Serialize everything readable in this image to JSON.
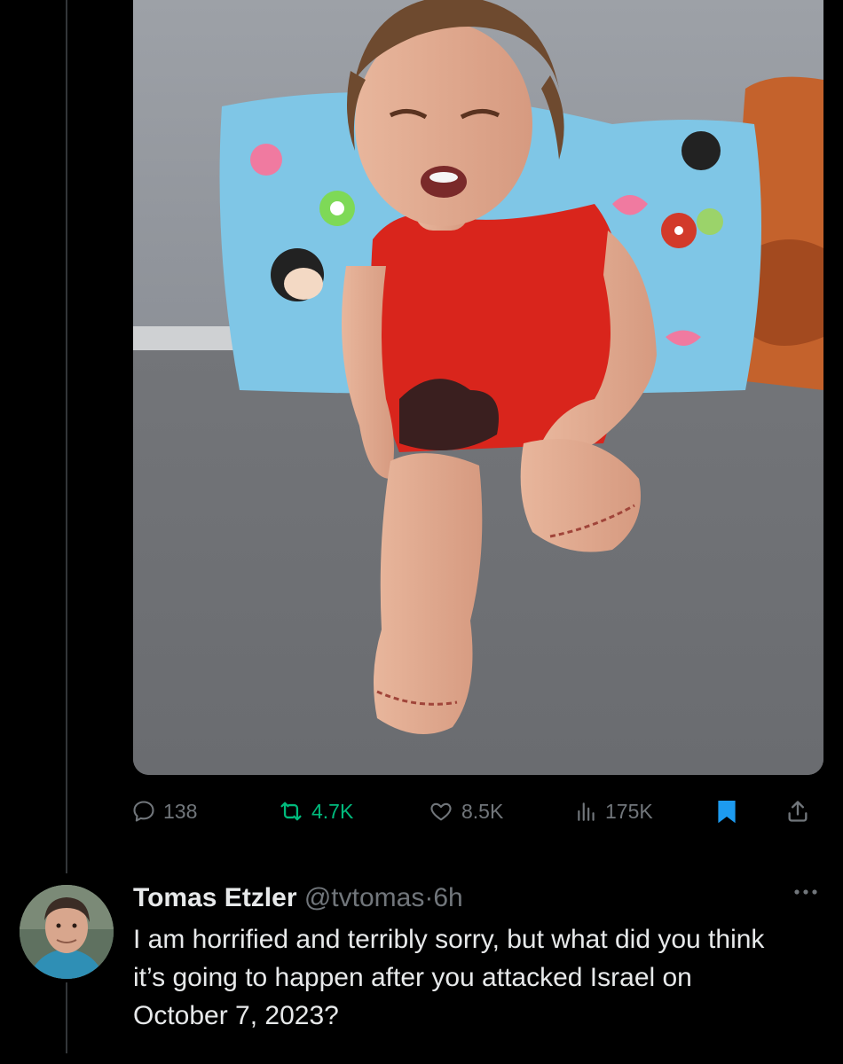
{
  "post": {
    "media_alt": "Photo of a crying toddler in a red top sitting on a grey mattress in front of cartoon pillows, with both lower legs amputated",
    "metrics": {
      "replies": "138",
      "reposts": "4.7K",
      "likes": "8.5K",
      "views": "175K"
    }
  },
  "reply": {
    "display_name": "Tomas Etzler",
    "handle": "@tvtomas",
    "separator": "·",
    "time": "6h",
    "text": "I am horrified and terribly sorry, but what did you think it’s going to happen after you attacked Israel on October 7, 2023?"
  },
  "icons": {
    "reply": "speech-bubble-icon",
    "repost": "repost-arrows-icon",
    "like": "heart-icon",
    "views": "bar-chart-icon",
    "bookmark": "bookmark-filled-icon",
    "share": "share-icon",
    "more": "more-dots-icon"
  },
  "colors": {
    "background": "#000000",
    "text_primary": "#e7e9ea",
    "text_secondary": "#71767b",
    "repost_active": "#00ba7c",
    "bookmark_active": "#1d9bf0",
    "thread_line": "#333639"
  }
}
